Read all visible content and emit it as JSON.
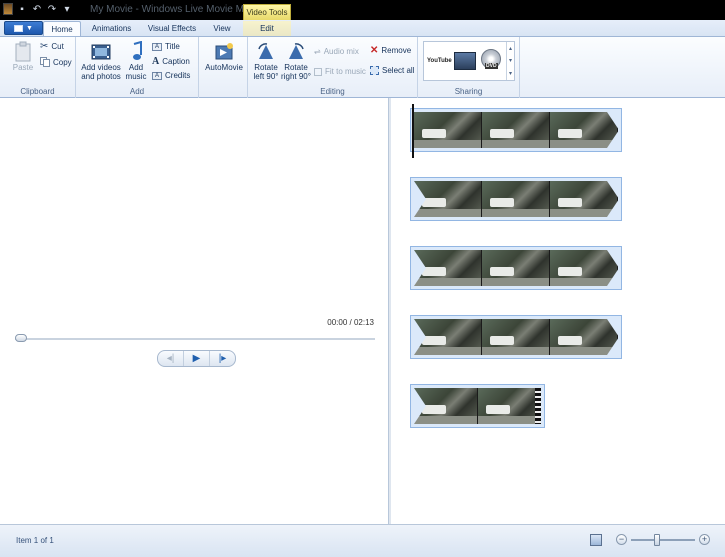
{
  "titlebar": {
    "title": "My Movie - Windows Live Movie Maker",
    "context_tab_group": "Video Tools"
  },
  "tabs": {
    "home": "Home",
    "animations": "Animations",
    "visual_effects": "Visual Effects",
    "view": "View",
    "edit": "Edit"
  },
  "ribbon": {
    "clipboard": {
      "label": "Clipboard",
      "paste": "Paste",
      "cut": "Cut",
      "copy": "Copy"
    },
    "add": {
      "label": "Add",
      "add_videos_line1": "Add videos",
      "add_videos_line2": "and photos",
      "add_music_line1": "Add",
      "add_music_line2": "music",
      "title": "Title",
      "caption": "Caption",
      "credits": "Credits"
    },
    "automovie": {
      "label": "AutoMovie"
    },
    "editing": {
      "label": "Editing",
      "rotate_left_line1": "Rotate",
      "rotate_left_line2": "left 90°",
      "rotate_right_line1": "Rotate",
      "rotate_right_line2": "right 90°",
      "audio_mix": "Audio mix",
      "fit_to_music": "Fit to music",
      "remove": "Remove",
      "select_all": "Select all"
    },
    "sharing": {
      "label": "Sharing",
      "youtube": "YouTube",
      "dvd": "DVD"
    }
  },
  "player": {
    "timecode": "00:00 / 02:13",
    "progress": 0
  },
  "storyboard": {
    "rows": 5
  },
  "status": {
    "text": "Item 1 of 1",
    "zoom_level": 0.4
  },
  "colors": {
    "ribbon_bg": "#e7eef8",
    "accent": "#1d57ad",
    "context_tab": "#e8d96a"
  }
}
